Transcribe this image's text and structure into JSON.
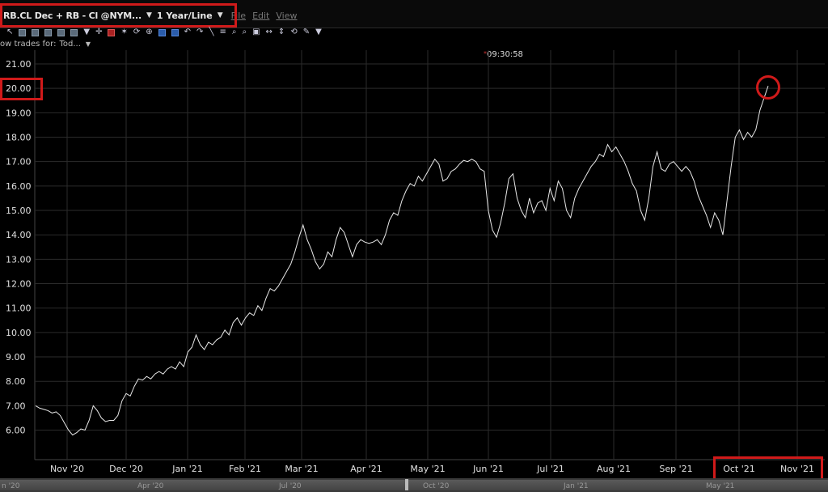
{
  "window": {
    "title": "RB.CL Dec + RB - Cl @NYM...",
    "period": "1 Year/Line",
    "menus": [
      "File",
      "Edit",
      "View"
    ]
  },
  "toolbar": {
    "show_trades_label": "ow trades for:",
    "show_trades_value": "Tod..."
  },
  "time_label": "09:30:58",
  "colors": {
    "background": "#000000",
    "line": "#e8e8e8",
    "highlight": "#d01a1a",
    "grid": "#2b2b2b"
  },
  "scrollbar": {
    "labels": [
      "n '20",
      "Apr '20",
      "Jul '20",
      "Oct '20",
      "Jan '21",
      "May '21"
    ]
  },
  "chart_data": {
    "type": "line",
    "xlabel": "",
    "ylabel": "",
    "ylim": [
      5.3,
      21.5
    ],
    "y_ticks": [
      "21.00",
      "20.00",
      "19.00",
      "18.00",
      "17.00",
      "16.00",
      "15.00",
      "14.00",
      "13.00",
      "12.00",
      "11.00",
      "10.00",
      "9.00",
      "8.00",
      "7.00",
      "6.00"
    ],
    "x_ticks": [
      "Nov '20",
      "Dec '20",
      "Jan '21",
      "Feb '21",
      "Mar '21",
      "Apr '21",
      "May '21",
      "Jun '21",
      "Jul '21",
      "Aug '21",
      "Sep '21",
      "Oct '21",
      "Nov '21"
    ],
    "grid": true,
    "series": [
      {
        "values": [
          7.0,
          6.9,
          6.85,
          6.8,
          6.7,
          6.75,
          6.6,
          6.3,
          6.0,
          5.8,
          5.9,
          6.05,
          6.0,
          6.4,
          7.0,
          6.8,
          6.5,
          6.35,
          6.4,
          6.4,
          6.6,
          7.2,
          7.5,
          7.4,
          7.8,
          8.1,
          8.05,
          8.2,
          8.1,
          8.3,
          8.4,
          8.3,
          8.5,
          8.6,
          8.5,
          8.8,
          8.6,
          9.2,
          9.4,
          9.9,
          9.5,
          9.3,
          9.6,
          9.5,
          9.7,
          9.8,
          10.1,
          9.9,
          10.4,
          10.6,
          10.3,
          10.6,
          10.8,
          10.7,
          11.1,
          10.9,
          11.4,
          11.8,
          11.7,
          11.9,
          12.2,
          12.5,
          12.8,
          13.3,
          13.9,
          14.4,
          13.8,
          13.4,
          12.9,
          12.6,
          12.8,
          13.3,
          13.1,
          13.8,
          14.3,
          14.1,
          13.6,
          13.1,
          13.6,
          13.8,
          13.7,
          13.65,
          13.7,
          13.8,
          13.6,
          14.0,
          14.6,
          14.9,
          14.8,
          15.4,
          15.8,
          16.1,
          16.0,
          16.4,
          16.2,
          16.5,
          16.8,
          17.1,
          16.9,
          16.2,
          16.3,
          16.6,
          16.7,
          16.9,
          17.05,
          17.0,
          17.1,
          17.0,
          16.7,
          16.6,
          15.0,
          14.2,
          13.9,
          14.5,
          15.3,
          16.3,
          16.5,
          15.5,
          15.0,
          14.7,
          15.5,
          14.9,
          15.3,
          15.4,
          15.0,
          15.9,
          15.4,
          16.2,
          15.9,
          15.0,
          14.7,
          15.5,
          15.9,
          16.2,
          16.5,
          16.8,
          17.0,
          17.3,
          17.2,
          17.7,
          17.4,
          17.6,
          17.3,
          17.0,
          16.6,
          16.1,
          15.8,
          15.0,
          14.6,
          15.5,
          16.8,
          17.4,
          16.7,
          16.6,
          16.9,
          17.0,
          16.8,
          16.6,
          16.8,
          16.6,
          16.2,
          15.6,
          15.2,
          14.8,
          14.3,
          14.9,
          14.6,
          14.0,
          15.4,
          16.8,
          18.0,
          18.3,
          17.9,
          18.2,
          18.0,
          18.3,
          19.1,
          19.6,
          20.1
        ]
      }
    ]
  }
}
